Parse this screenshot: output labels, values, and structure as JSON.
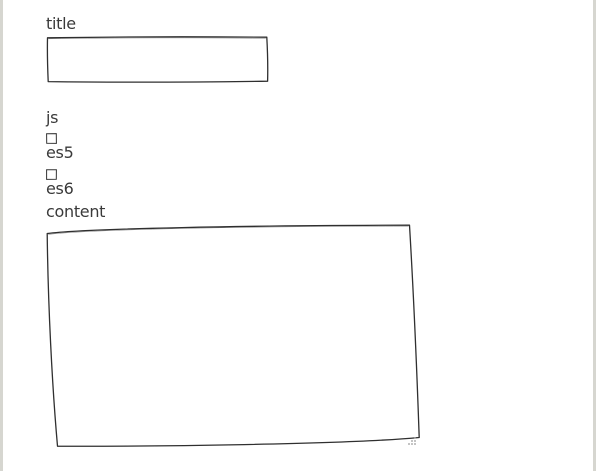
{
  "form": {
    "title_label": "title",
    "title_value": "",
    "js_label": "js",
    "es5_label": "es5",
    "es5_checked": false,
    "es6_label": "es6",
    "es6_checked": false,
    "content_label": "content",
    "content_value": ""
  },
  "colors": {
    "frame": "#d6d6d0",
    "stroke": "#2f2f2f",
    "text": "#3a3a3a"
  },
  "icons": {
    "resize_grip": "resize-grip-icon"
  }
}
